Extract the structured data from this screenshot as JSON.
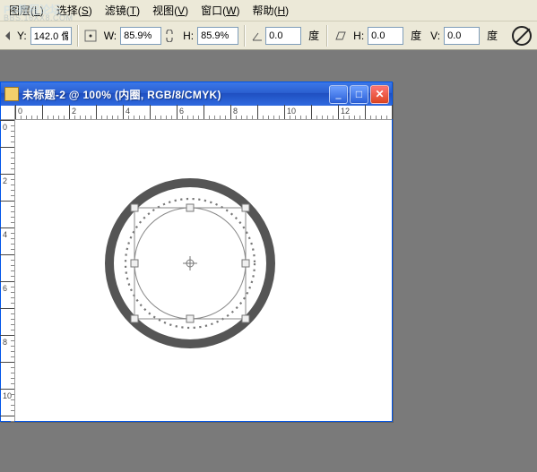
{
  "watermark": {
    "line1": "PS教程论坛",
    "line2": "BBS.16XX8.COM"
  },
  "menu": {
    "items": [
      {
        "label": "图层",
        "key": "L"
      },
      {
        "label": "选择",
        "key": "S"
      },
      {
        "label": "滤镜",
        "key": "T"
      },
      {
        "label": "视图",
        "key": "V"
      },
      {
        "label": "窗口",
        "key": "W"
      },
      {
        "label": "帮助",
        "key": "H"
      }
    ]
  },
  "options": {
    "y": {
      "label": "Y:",
      "value": "142.0 像"
    },
    "w": {
      "label": "W:",
      "value": "85.9%"
    },
    "h": {
      "label": "H:",
      "value": "85.9%"
    },
    "rot": {
      "value": "0.0",
      "unit": "度"
    },
    "skew_h": {
      "label": "H:",
      "value": "0.0",
      "unit": "度"
    },
    "skew_v": {
      "label": "V:",
      "value": "0.0",
      "unit": "度"
    }
  },
  "doc": {
    "title": "未标题-2 @ 100% (内圈, RGB/8/CMYK)",
    "ruler_h": [
      "0",
      "2",
      "4",
      "6",
      "8",
      "10",
      "12"
    ],
    "ruler_v": [
      "0",
      "2",
      "4",
      "6",
      "8",
      "10"
    ]
  }
}
